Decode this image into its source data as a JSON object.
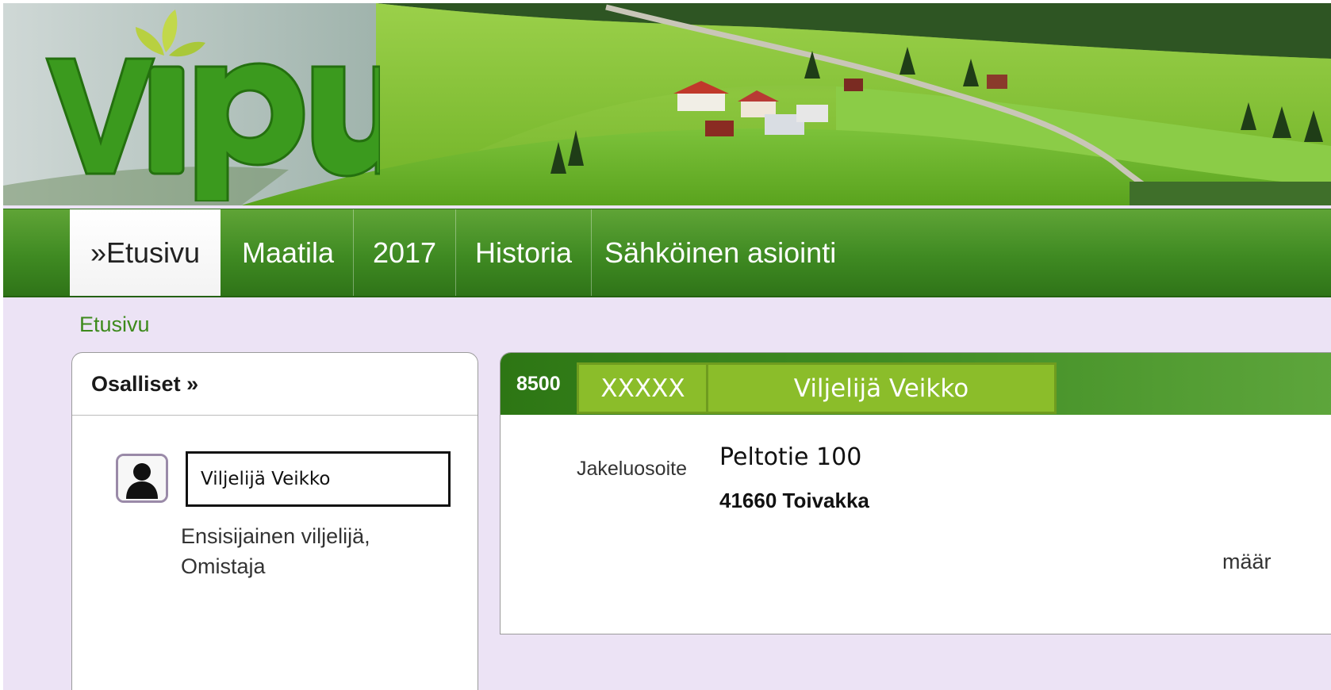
{
  "header": {
    "logo_text": "vipu"
  },
  "nav": {
    "tabs": [
      {
        "label": "»Etusivu",
        "active": true
      },
      {
        "label": "Maatila",
        "active": false
      },
      {
        "label": "2017",
        "active": false
      },
      {
        "label": "Historia",
        "active": false
      },
      {
        "label": "Sähköinen asiointi",
        "active": false
      }
    ]
  },
  "breadcrumb": "Etusivu",
  "parties_panel": {
    "title": "Osalliset »",
    "person_name": "Viljelijä Veikko",
    "role": "Ensisijainen viljelijä, Omistaja"
  },
  "farm_panel": {
    "farm_id_prefix": "8500",
    "farm_id_masked": "XXXXX",
    "farmer_name": "Viljelijä Veikko",
    "address_label": "Jakeluosoite",
    "street": "Peltotie 100",
    "postal": "41660  Toivakka",
    "truncated_text": "määr"
  },
  "colors": {
    "nav_green": "#3f8a22",
    "highlight_green": "#8bbd2a",
    "content_bg": "#ece3f5",
    "link_green": "#3d8a1c"
  }
}
